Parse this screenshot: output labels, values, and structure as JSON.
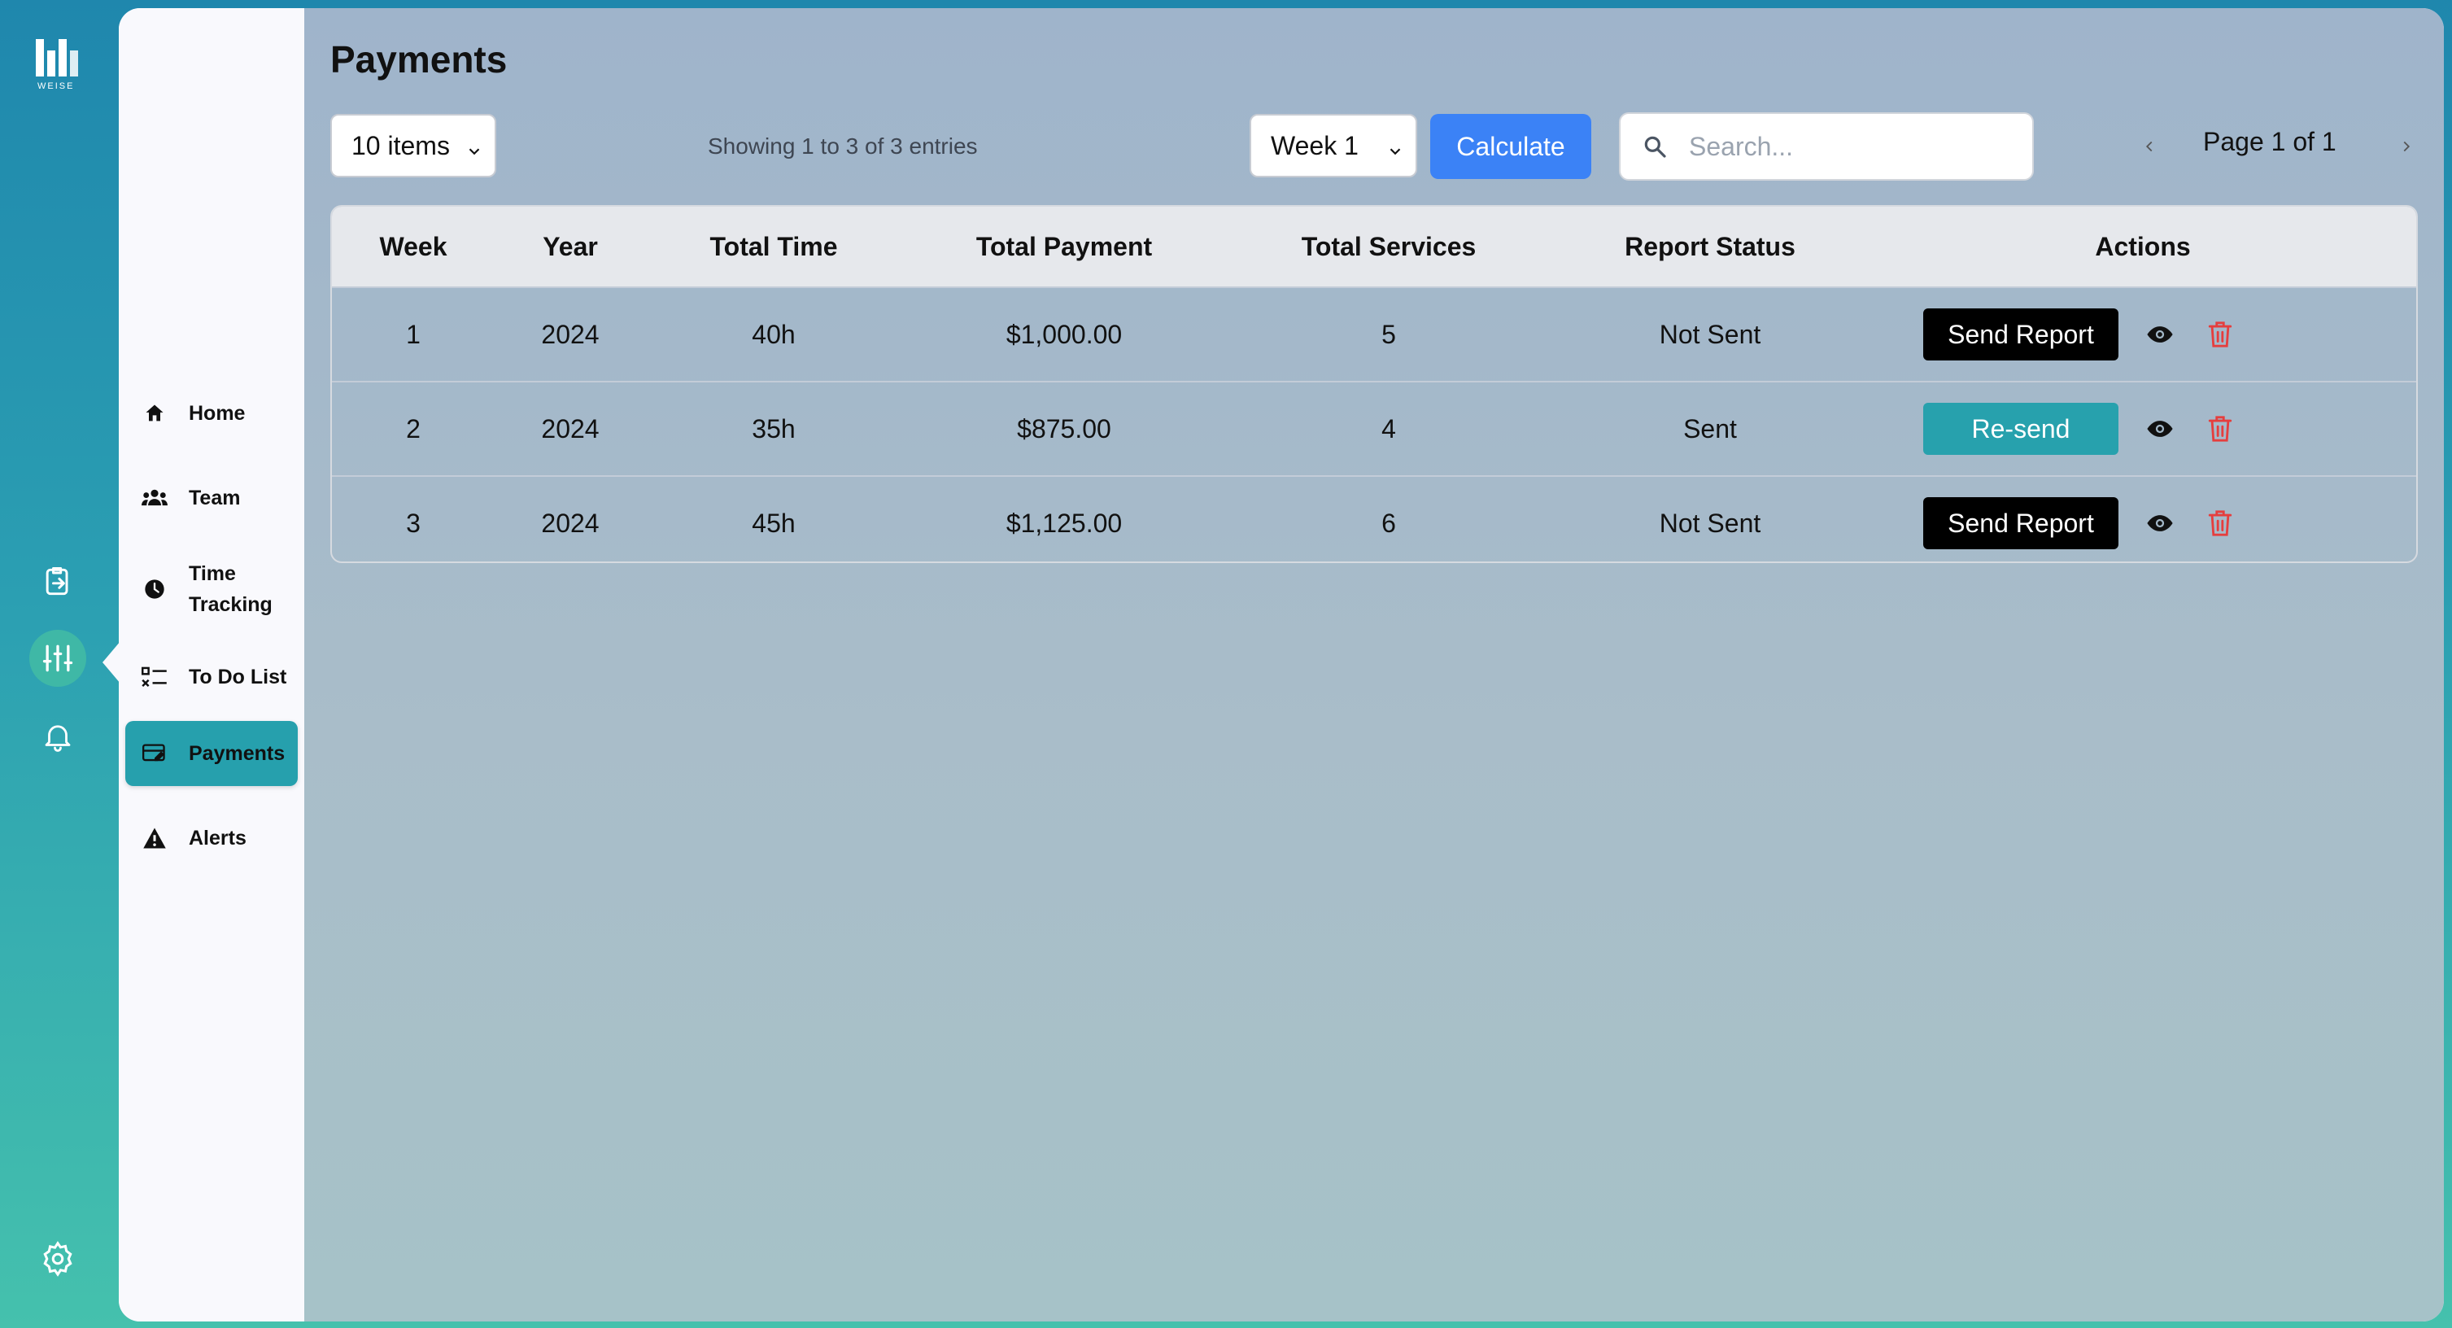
{
  "brand": {
    "logo_text": "WEISE"
  },
  "sidebar": {
    "items": [
      {
        "label": "Home",
        "icon": "home-icon"
      },
      {
        "label": "Team",
        "icon": "team-icon"
      },
      {
        "label": "Time Tracking",
        "icon": "clock-icon"
      },
      {
        "label": "To Do List",
        "icon": "checklist-icon"
      },
      {
        "label": "Payments",
        "icon": "payment-icon",
        "active": true
      },
      {
        "label": "Alerts",
        "icon": "alert-icon"
      }
    ]
  },
  "rail": {
    "icons": [
      "clipboard-share-icon",
      "sliders-icon",
      "bell-icon",
      "settings-icon"
    ],
    "active": "sliders-icon"
  },
  "page": {
    "title": "Payments"
  },
  "toolbar": {
    "page_size": "10 items",
    "showing_text": "Showing 1 to 3 of 3 entries",
    "week_select": "Week 1",
    "calculate_label": "Calculate",
    "search_placeholder": "Search...",
    "pagination_text": "Page 1 of 1"
  },
  "table": {
    "headers": [
      "Week",
      "Year",
      "Total Time",
      "Total Payment",
      "Total Services",
      "Report Status",
      "Actions"
    ],
    "rows": [
      {
        "week": "1",
        "year": "2024",
        "time": "40h",
        "payment": "$1,000.00",
        "services": "5",
        "status": "Not Sent",
        "action": "Send Report"
      },
      {
        "week": "2",
        "year": "2024",
        "time": "35h",
        "payment": "$875.00",
        "services": "4",
        "status": "Sent",
        "action": "Re-send"
      },
      {
        "week": "3",
        "year": "2024",
        "time": "45h",
        "payment": "$1,125.00",
        "services": "6",
        "status": "Not Sent",
        "action": "Send Report"
      }
    ]
  },
  "colors": {
    "accent_teal": "#27a1ad",
    "calculate_blue": "#3b82f6",
    "delete_red": "#e53e3e"
  }
}
